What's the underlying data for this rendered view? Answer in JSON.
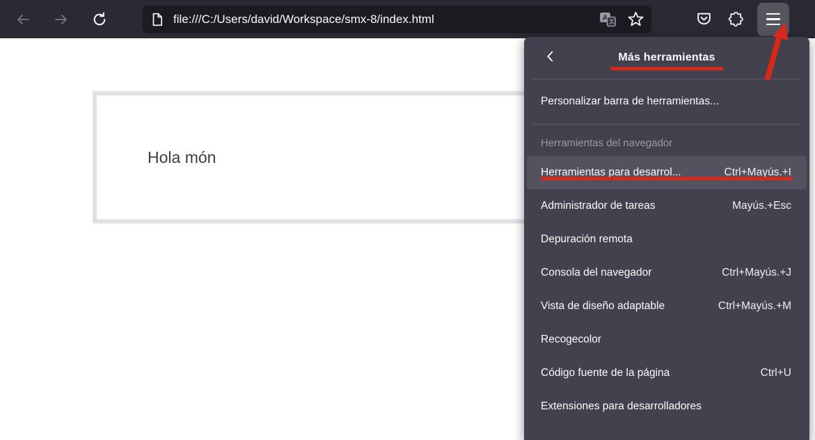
{
  "browser": {
    "url": "file:///C:/Users/david/Workspace/smx-8/index.html"
  },
  "page": {
    "greeting": "Hola món"
  },
  "menu": {
    "title": "Más herramientas",
    "customize": {
      "label": "Personalizar barra de herramientas...",
      "shortcut": ""
    },
    "section_header": "Herramientas del navegador",
    "items": [
      {
        "label": "Herramientas para desarrol...",
        "shortcut": "Ctrl+Mayús.+I"
      },
      {
        "label": "Administrador de tareas",
        "shortcut": "Mayús.+Esc"
      },
      {
        "label": "Depuración remota",
        "shortcut": ""
      },
      {
        "label": "Consola del navegador",
        "shortcut": "Ctrl+Mayús.+J"
      },
      {
        "label": "Vista de diseño adaptable",
        "shortcut": "Ctrl+Mayús.+M"
      },
      {
        "label": "Recogecolor",
        "shortcut": ""
      },
      {
        "label": "Código fuente de la página",
        "shortcut": "Ctrl+U"
      },
      {
        "label": "Extensiones para desarrolladores",
        "shortcut": ""
      }
    ]
  },
  "icons": {
    "back": "back-icon",
    "forward": "forward-icon",
    "reload": "reload-icon",
    "page": "page-icon",
    "translate": "translate-icon",
    "star": "bookmark-star-icon",
    "pocket": "pocket-icon",
    "extensions": "extensions-icon",
    "hamburger": "menu-icon",
    "panel_back": "chevron-left-icon"
  },
  "colors": {
    "annotation_red": "#d7281c",
    "toolbar_bg": "#2b2a33",
    "urlbar_bg": "#1c1b22",
    "panel_bg": "#42414d",
    "highlight_bg": "#53525e",
    "page_box_border": "#dfe2e5"
  }
}
